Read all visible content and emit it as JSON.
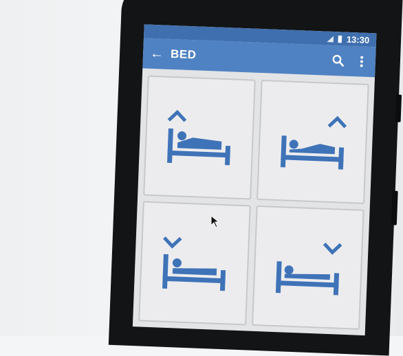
{
  "status_bar": {
    "time": "13:30"
  },
  "app_bar": {
    "title": "BED",
    "back_icon": "arrow-back-icon",
    "search_icon": "search-icon",
    "menu_icon": "more-vert-icon"
  },
  "tiles": [
    {
      "id": "head-up",
      "icon": "bed-head-up-icon",
      "arrow": "up",
      "arrow_side": "left"
    },
    {
      "id": "foot-up",
      "icon": "bed-foot-up-icon",
      "arrow": "up",
      "arrow_side": "right"
    },
    {
      "id": "head-down",
      "icon": "bed-head-down-icon",
      "arrow": "down",
      "arrow_side": "left"
    },
    {
      "id": "foot-down",
      "icon": "bed-foot-down-icon",
      "arrow": "down",
      "arrow_side": "right"
    }
  ],
  "colors": {
    "appbar": "#4f82c3",
    "statusbar": "#3f6fae",
    "icon_blue": "#3f73b8",
    "tile_bg": "#ececee"
  }
}
